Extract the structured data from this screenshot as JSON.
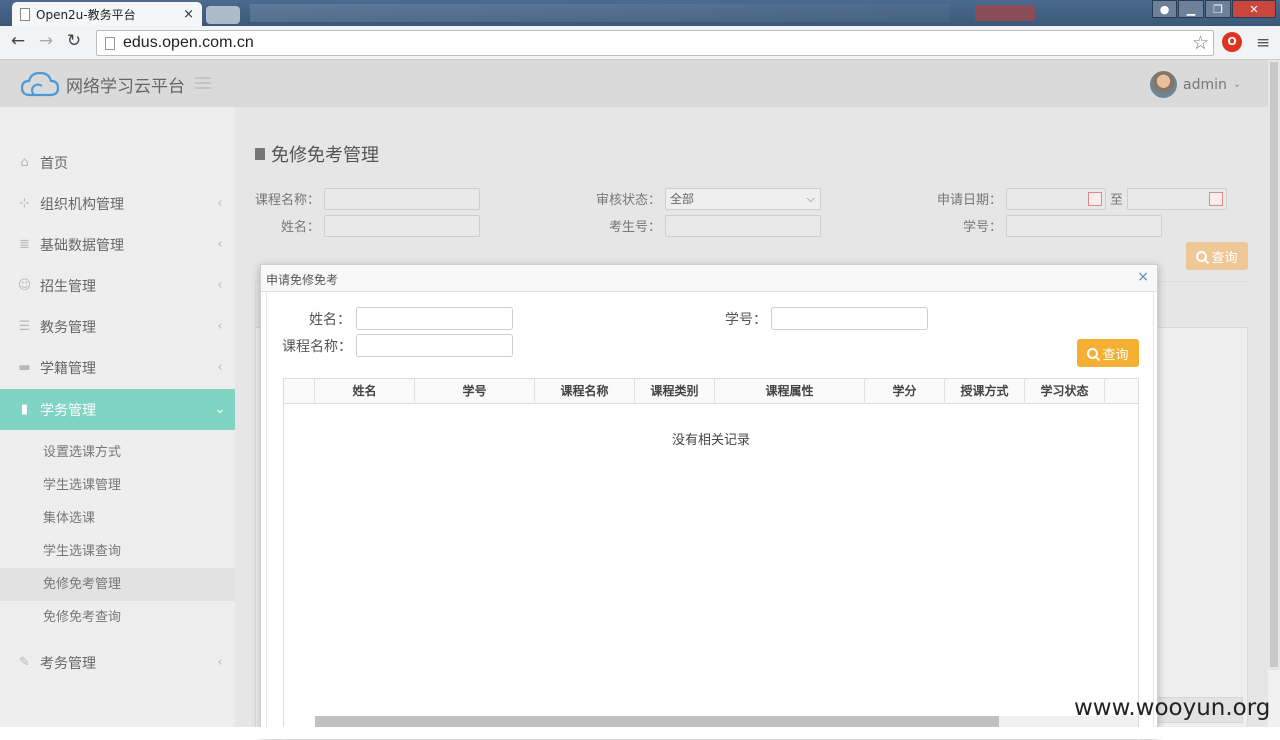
{
  "browser": {
    "tab_title": "Open2u-教务平台",
    "tab_close": "×",
    "url": "edus.open.com.cn",
    "star": "☆",
    "menu": "≡",
    "ext_icon": "O",
    "back": "←",
    "forward": "→",
    "reload": "↻"
  },
  "app": {
    "logo_text": "网络学习云平台",
    "username": "admin",
    "user_caret": "⌄"
  },
  "sidebar": {
    "items": [
      {
        "label": "首页",
        "icon": "home-icon",
        "glyph": "⌂"
      },
      {
        "label": "组织机构管理",
        "icon": "sitemap-icon",
        "glyph": "⊹",
        "arrow": "‹"
      },
      {
        "label": "基础数据管理",
        "icon": "database-icon",
        "glyph": "≣",
        "arrow": "‹"
      },
      {
        "label": "招生管理",
        "icon": "users-icon",
        "glyph": "☺",
        "arrow": "‹"
      },
      {
        "label": "教务管理",
        "icon": "list-icon",
        "glyph": "☰",
        "arrow": "‹"
      },
      {
        "label": "学籍管理",
        "icon": "folder-icon",
        "glyph": "▬",
        "arrow": "‹"
      },
      {
        "label": "学务管理",
        "icon": "file-icon",
        "glyph": "▮",
        "arrow": "⌄"
      },
      {
        "label": "考务管理",
        "icon": "edit-icon",
        "glyph": "✎",
        "arrow": "‹"
      }
    ],
    "sub_items": [
      "设置选课方式",
      "学生选课管理",
      "集体选课",
      "学生选课查询",
      "免修免考管理",
      "免修免考查询"
    ]
  },
  "page": {
    "title": "免修免考管理",
    "filters": {
      "course_name": "课程名称：",
      "audit_status": "审核状态：",
      "audit_value": "全部",
      "apply_date": "申请日期：",
      "to": "至",
      "name": "姓名：",
      "exam_no": "考生号：",
      "student_no": "学号："
    },
    "query_btn": "查询"
  },
  "modal": {
    "title": "申请免修免考",
    "close": "×",
    "name_label": "姓名：",
    "student_no_label": "学号：",
    "course_label": "课程名称：",
    "query_btn": "查询",
    "columns": [
      "姓名",
      "学号",
      "课程名称",
      "课程类别",
      "课程属性",
      "学分",
      "授课方式",
      "学习状态"
    ],
    "empty_text": "没有相关记录"
  },
  "watermark": "www.wooyun.org"
}
